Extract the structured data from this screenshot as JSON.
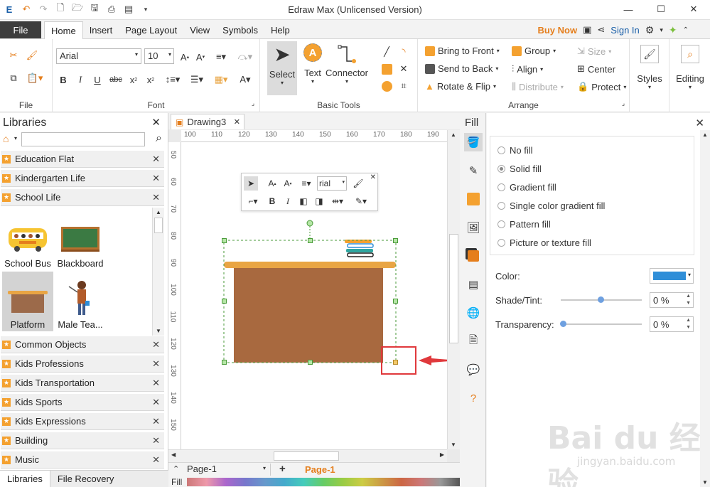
{
  "window": {
    "title": "Edraw Max (Unlicensed Version)",
    "minimize": "—",
    "maximize": "☐",
    "close": "✕"
  },
  "menu": {
    "file": "File",
    "tabs": [
      "Home",
      "Insert",
      "Page Layout",
      "View",
      "Symbols",
      "Help"
    ],
    "buy_now": "Buy Now",
    "sign_in": "Sign In"
  },
  "ribbon": {
    "file_group_label": "File",
    "font": {
      "label": "Font",
      "family": "Arial",
      "size": "10"
    },
    "basic_tools": {
      "label": "Basic Tools",
      "select": "Select",
      "text": "Text",
      "connector": "Connector"
    },
    "arrange": {
      "label": "Arrange",
      "bring_to_front": "Bring to Front",
      "send_to_back": "Send to Back",
      "rotate_flip": "Rotate & Flip",
      "group": "Group",
      "align": "Align",
      "distribute": "Distribute",
      "size": "Size",
      "center": "Center",
      "protect": "Protect"
    },
    "styles": "Styles",
    "editing": "Editing"
  },
  "libraries": {
    "title": "Libraries",
    "items_top": [
      "Education Flat",
      "Kindergarten Life",
      "School Life"
    ],
    "shapes": [
      "School Bus",
      "Blackboard",
      "Platform",
      "Male Tea..."
    ],
    "items_bottom": [
      "Common Objects",
      "Kids Professions",
      "Kids Transportation",
      "Kids Sports",
      "Kids Expressions",
      "Building",
      "Music"
    ],
    "tabs": [
      "Libraries",
      "File Recovery"
    ]
  },
  "document": {
    "tab": "Drawing3",
    "ruler_top": [
      "100",
      "110",
      "120",
      "130",
      "140",
      "150",
      "160",
      "170",
      "180",
      "190"
    ],
    "ruler_left": [
      "50",
      "60",
      "70",
      "80",
      "90",
      "100",
      "110",
      "120",
      "130",
      "140",
      "150"
    ],
    "float_font": "rial",
    "page_select": "Page-1",
    "page_tab": "Page-1",
    "fill_label": "Fill"
  },
  "fill_panel": {
    "title": "Fill",
    "options": [
      "No fill",
      "Solid fill",
      "Gradient fill",
      "Single color gradient fill",
      "Pattern fill",
      "Picture or texture fill"
    ],
    "selected": "Solid fill",
    "color_label": "Color:",
    "color_value": "#2f8ed8",
    "shade_label": "Shade/Tint:",
    "shade_value": "0 %",
    "transparency_label": "Transparency:",
    "transparency_value": "0 %"
  },
  "colors": {
    "accent_orange": "#f4a130",
    "desk_body": "#a8693f",
    "desk_top": "#e9a544",
    "highlight_red": "#e0393c"
  },
  "watermark": {
    "main": "Bai du 经验",
    "sub": "jingyan.baidu.com"
  }
}
